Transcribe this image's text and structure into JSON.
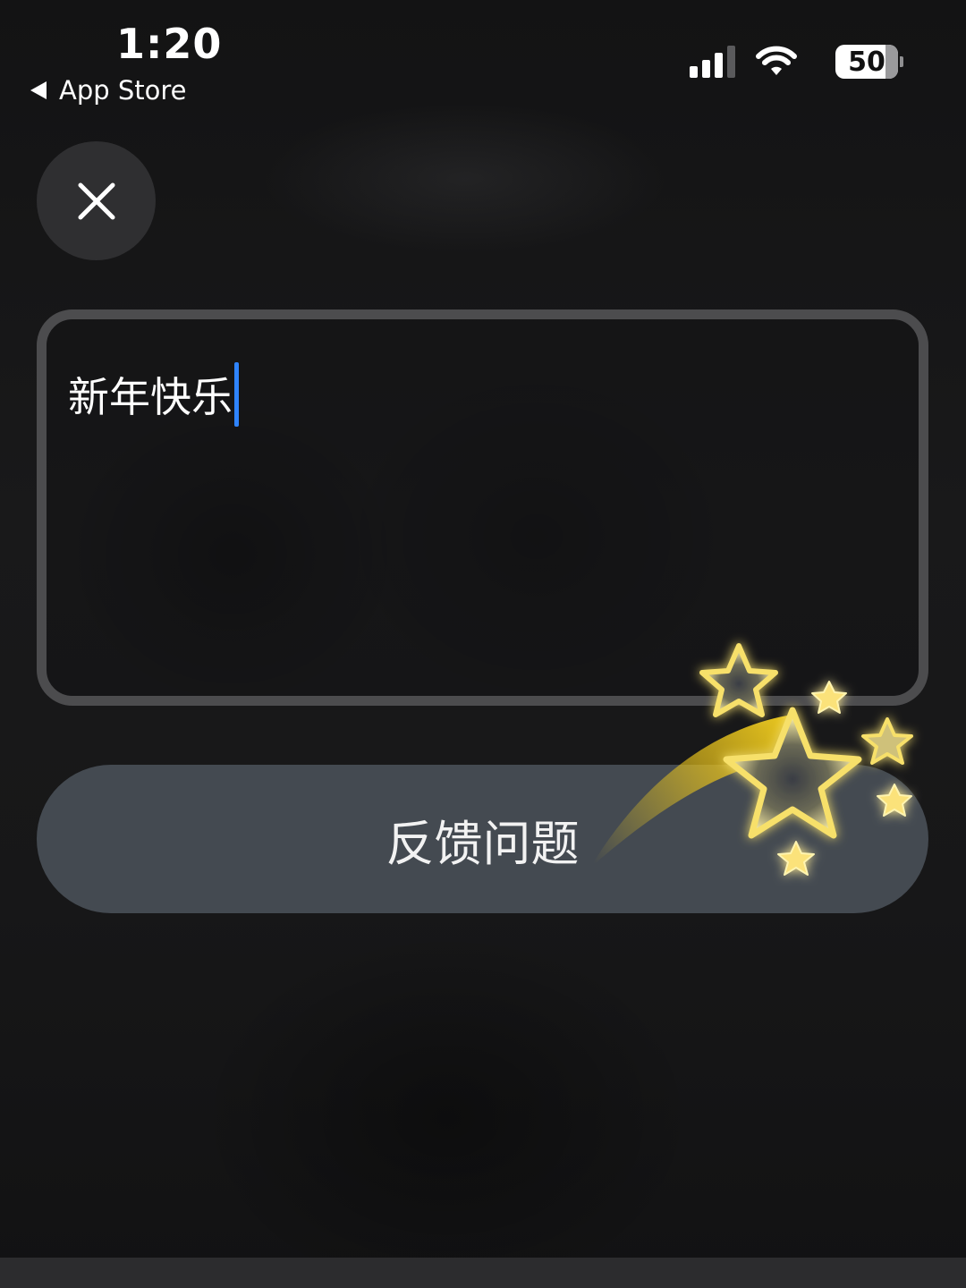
{
  "status_bar": {
    "time": "1:20",
    "back_label": "App Store",
    "battery_level": "50",
    "signal_bars_filled": 3,
    "signal_bars_total": 4
  },
  "close_button": {
    "icon": "close-icon"
  },
  "feedback_input": {
    "value": "新年快乐"
  },
  "feedback_button": {
    "label": "反馈问题"
  },
  "decoration": {
    "icon": "star-icon",
    "accent_color": "#f7d21e"
  }
}
